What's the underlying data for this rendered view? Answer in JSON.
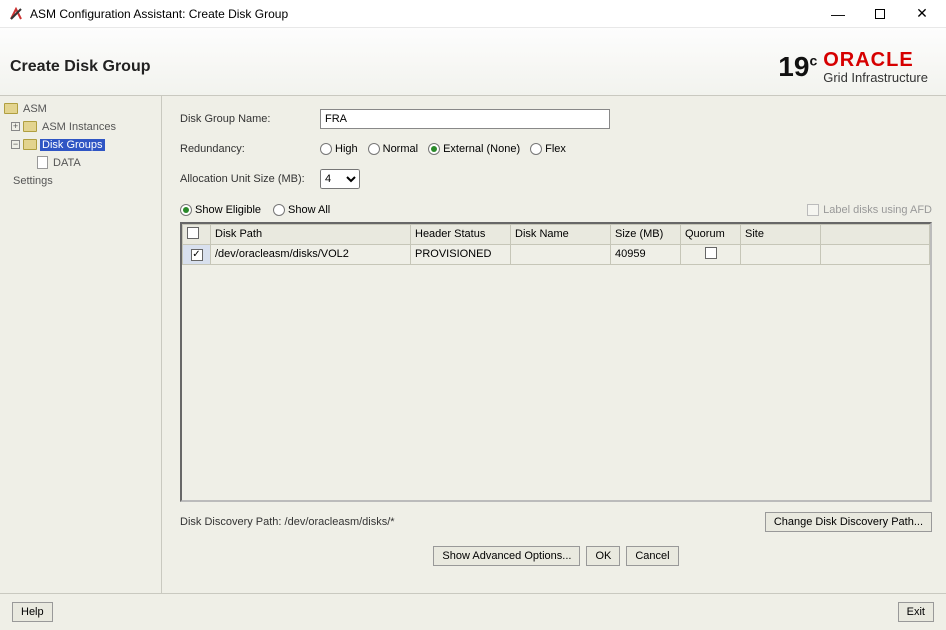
{
  "window": {
    "title": "ASM Configuration Assistant: Create Disk Group"
  },
  "header": {
    "title": "Create Disk Group",
    "version": "19",
    "version_suffix": "c",
    "brand": "ORACLE",
    "brand_sub": "Grid Infrastructure"
  },
  "sidebar": {
    "root": "ASM",
    "instances": "ASM Instances",
    "disk_groups": "Disk Groups",
    "data": "DATA",
    "settings": "Settings"
  },
  "form": {
    "disk_group_name_label": "Disk Group Name:",
    "disk_group_name_value": "FRA",
    "redundancy_label": "Redundancy:",
    "redundancy": {
      "high": "High",
      "normal": "Normal",
      "external": "External (None)",
      "flex": "Flex",
      "selected": "external"
    },
    "alloc_label": "Allocation Unit Size (MB):",
    "alloc_value": "4",
    "filter": {
      "eligible": "Show Eligible",
      "all": "Show All",
      "selected": "eligible"
    },
    "afd_label": "Label disks using AFD"
  },
  "grid": {
    "columns": [
      "",
      "Disk Path",
      "Header Status",
      "Disk Name",
      "Size (MB)",
      "Quorum",
      "Site"
    ],
    "rows": [
      {
        "checked": true,
        "disk_path": "/dev/oracleasm/disks/VOL2",
        "header_status": "PROVISIONED",
        "disk_name": "",
        "size_mb": "40959",
        "quorum": false,
        "site": ""
      }
    ]
  },
  "discovery": {
    "label": "Disk Discovery Path: /dev/oracleasm/disks/*",
    "button": "Change Disk Discovery Path..."
  },
  "buttons": {
    "advanced": "Show Advanced Options...",
    "ok": "OK",
    "cancel": "Cancel",
    "help": "Help",
    "exit": "Exit"
  }
}
